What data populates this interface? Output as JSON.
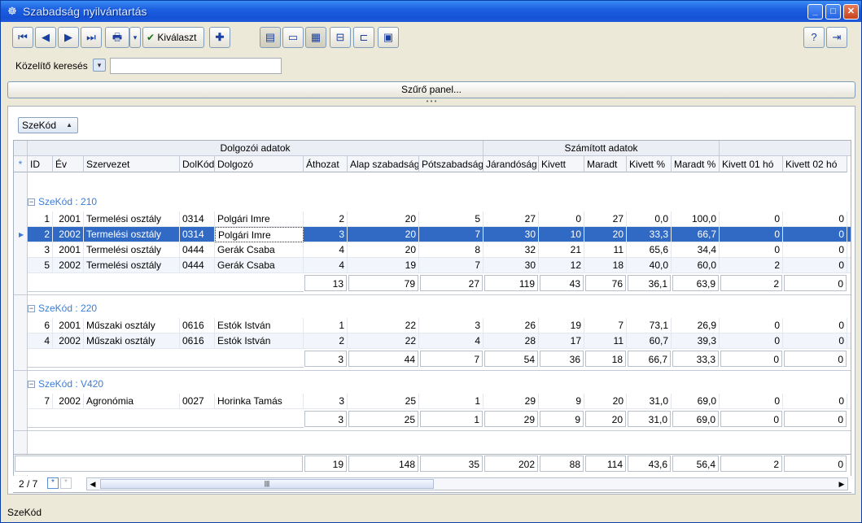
{
  "window": {
    "title": "Szabadság nyilvántartás"
  },
  "toolbar": {
    "select_label": "Kiválaszt"
  },
  "search": {
    "label": "Közelítő keresés",
    "value": ""
  },
  "filter": {
    "label": "Szűrő panel..."
  },
  "grouping": {
    "field": "SzeKód"
  },
  "bands": {
    "employee": "Dolgozói adatok",
    "computed": "Számított adatok"
  },
  "columns": [
    "ID",
    "Év",
    "Szervezet",
    "DolKód",
    "Dolgozó",
    "Áthozat",
    "Alap szabadság",
    "Pótszabadság",
    "Járandóság",
    "Kivett",
    "Maradt",
    "Kivett %",
    "Maradt %",
    "Kivett 01 hó",
    "Kivett 02 hó"
  ],
  "groups": [
    {
      "caption": "SzeKód : 210",
      "rows": [
        [
          "1",
          "2001",
          "Termelési osztály",
          "0314",
          "Polgári Imre",
          "2",
          "20",
          "5",
          "27",
          "0",
          "27",
          "0,0",
          "100,0",
          "0",
          "0"
        ],
        [
          "2",
          "2002",
          "Termelési osztály",
          "0314",
          "Polgári Imre",
          "3",
          "20",
          "7",
          "30",
          "10",
          "20",
          "33,3",
          "66,7",
          "0",
          "0"
        ],
        [
          "3",
          "2001",
          "Termelési osztály",
          "0444",
          "Gerák Csaba",
          "4",
          "20",
          "8",
          "32",
          "21",
          "11",
          "65,6",
          "34,4",
          "0",
          "0"
        ],
        [
          "5",
          "2002",
          "Termelési osztály",
          "0444",
          "Gerák Csaba",
          "4",
          "19",
          "7",
          "30",
          "12",
          "18",
          "40,0",
          "60,0",
          "2",
          "0"
        ]
      ],
      "totals": [
        "13",
        "79",
        "27",
        "119",
        "43",
        "76",
        "36,1",
        "63,9",
        "2",
        "0"
      ]
    },
    {
      "caption": "SzeKód : 220",
      "rows": [
        [
          "6",
          "2001",
          "Műszaki osztály",
          "0616",
          "Estók István",
          "1",
          "22",
          "3",
          "26",
          "19",
          "7",
          "73,1",
          "26,9",
          "0",
          "0"
        ],
        [
          "4",
          "2002",
          "Műszaki osztály",
          "0616",
          "Estók István",
          "2",
          "22",
          "4",
          "28",
          "17",
          "11",
          "60,7",
          "39,3",
          "0",
          "0"
        ]
      ],
      "totals": [
        "3",
        "44",
        "7",
        "54",
        "36",
        "18",
        "66,7",
        "33,3",
        "0",
        "0"
      ]
    },
    {
      "caption": "SzeKód : V420",
      "rows": [
        [
          "7",
          "2002",
          "Agronómia",
          "0027",
          "Horinka Tamás",
          "3",
          "25",
          "1",
          "29",
          "9",
          "20",
          "31,0",
          "69,0",
          "0",
          "0"
        ]
      ],
      "totals": [
        "3",
        "25",
        "1",
        "29",
        "9",
        "20",
        "31,0",
        "69,0",
        "0",
        "0"
      ]
    }
  ],
  "grand_totals": [
    "19",
    "148",
    "35",
    "202",
    "88",
    "114",
    "43,6",
    "56,4",
    "2",
    "0"
  ],
  "pager": {
    "position": "2 / 7"
  },
  "status": {
    "text": "SzeKód"
  },
  "colors": {
    "selection": "#316ac5",
    "group_caption": "#3a7dd8"
  }
}
